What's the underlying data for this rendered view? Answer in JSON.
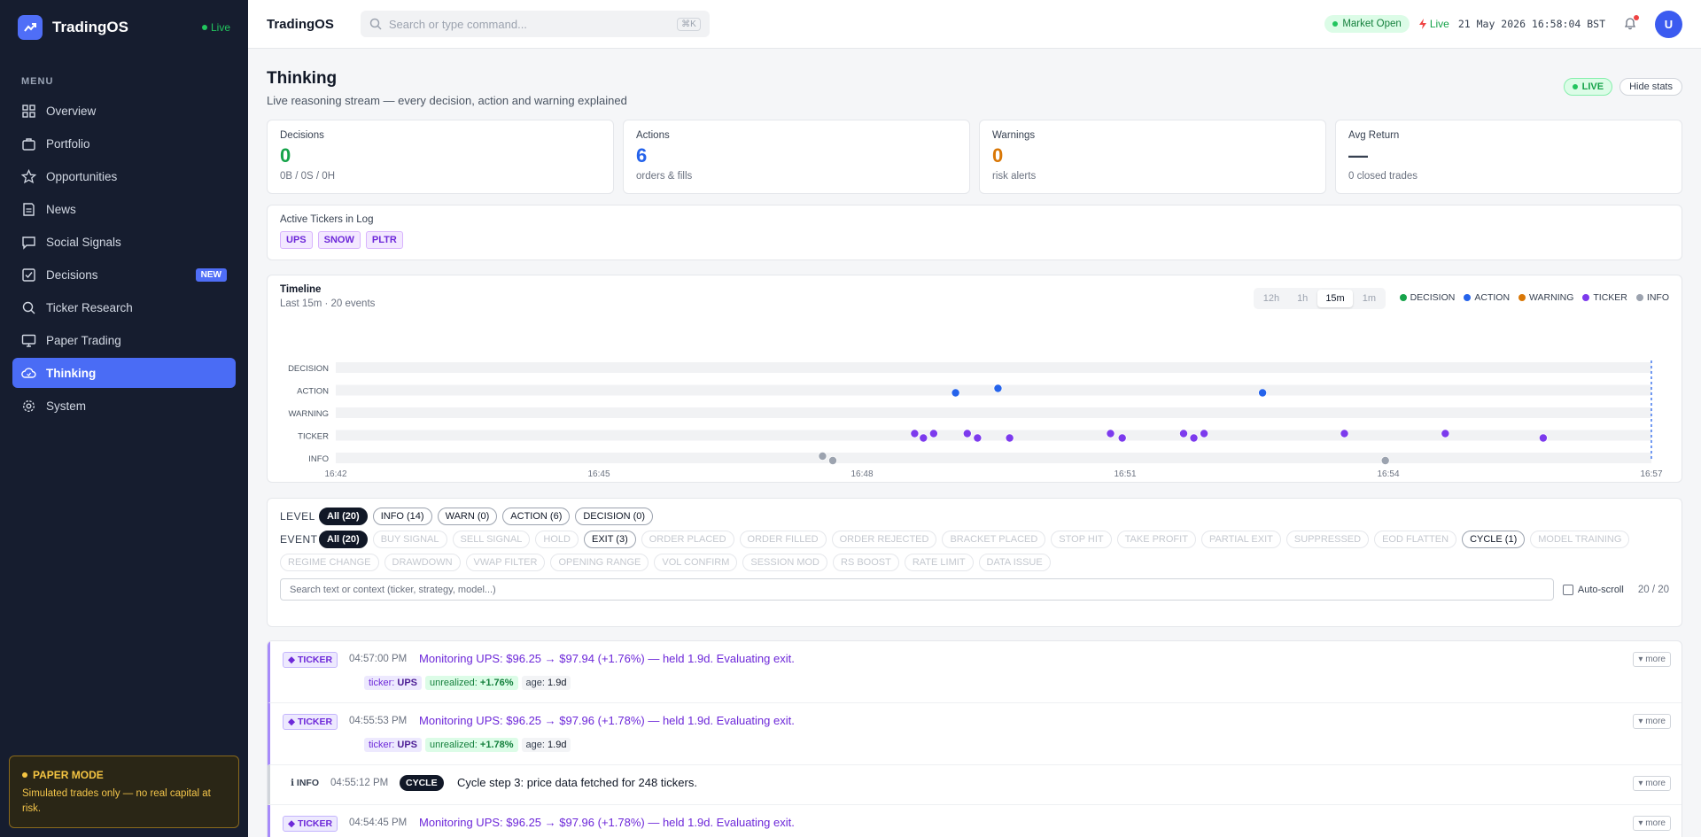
{
  "sidebar": {
    "brand": "TradingOS",
    "live": "Live",
    "menu_title": "MENU",
    "items": [
      {
        "label": "Overview",
        "icon": "grid-icon"
      },
      {
        "label": "Portfolio",
        "icon": "briefcase-icon"
      },
      {
        "label": "Opportunities",
        "icon": "star-icon"
      },
      {
        "label": "News",
        "icon": "newspaper-icon"
      },
      {
        "label": "Social Signals",
        "icon": "chat-icon"
      },
      {
        "label": "Decisions",
        "icon": "check-square-icon",
        "badge": "NEW"
      },
      {
        "label": "Ticker Research",
        "icon": "search-icon"
      },
      {
        "label": "Paper Trading",
        "icon": "monitor-icon"
      },
      {
        "label": "Thinking",
        "icon": "cloud-icon",
        "active": true
      },
      {
        "label": "System",
        "icon": "gear-icon"
      }
    ],
    "paper_mode": {
      "title": "PAPER MODE",
      "text": "Simulated trades only — no real capital at risk."
    }
  },
  "topbar": {
    "title": "TradingOS",
    "search_placeholder": "Search or type command...",
    "shortcut": "⌘K",
    "market": "Market Open",
    "live": "Live",
    "clock": "21 May 2026 16:58:04 BST",
    "avatar": "U"
  },
  "page": {
    "title": "Thinking",
    "subtitle": "Live reasoning stream — every decision, action and warning explained",
    "live_pill": "LIVE",
    "hide_stats": "Hide stats"
  },
  "stats": [
    {
      "label": "Decisions",
      "value": "0",
      "sub": "0B / 0S / 0H",
      "color": "#16a34a"
    },
    {
      "label": "Actions",
      "value": "6",
      "sub": "orders & fills",
      "color": "#2563eb"
    },
    {
      "label": "Warnings",
      "value": "0",
      "sub": "risk alerts",
      "color": "#d97706"
    },
    {
      "label": "Avg Return",
      "value": "—",
      "sub": "0 closed trades",
      "color": "#374151"
    }
  ],
  "active_tickers": {
    "label": "Active Tickers in Log",
    "items": [
      "UPS",
      "SNOW",
      "PLTR"
    ]
  },
  "timeline": {
    "title": "Timeline",
    "subtitle": "Last 15m · 20 events",
    "ranges": [
      "12h",
      "1h",
      "15m",
      "1m"
    ],
    "selected_range": "15m",
    "legend": [
      {
        "name": "DECISION",
        "color": "#16a34a"
      },
      {
        "name": "ACTION",
        "color": "#2563eb"
      },
      {
        "name": "WARNING",
        "color": "#d97706"
      },
      {
        "name": "TICKER",
        "color": "#7c3aed"
      },
      {
        "name": "INFO",
        "color": "#9ca3af"
      }
    ]
  },
  "chart_data": {
    "type": "scatter",
    "title": "Timeline",
    "lanes": [
      "DECISION",
      "ACTION",
      "WARNING",
      "TICKER",
      "INFO"
    ],
    "x_ticks": [
      "16:42",
      "16:45",
      "16:48",
      "16:51",
      "16:54",
      "16:57"
    ],
    "xlim": [
      "16:42:00",
      "16:57:00"
    ],
    "points": [
      {
        "t": "16:47:33",
        "lane": "INFO"
      },
      {
        "t": "16:47:40",
        "lane": "INFO"
      },
      {
        "t": "16:48:36",
        "lane": "TICKER"
      },
      {
        "t": "16:48:42",
        "lane": "TICKER"
      },
      {
        "t": "16:48:49",
        "lane": "TICKER"
      },
      {
        "t": "16:49:04",
        "lane": "ACTION"
      },
      {
        "t": "16:49:12",
        "lane": "TICKER"
      },
      {
        "t": "16:49:19",
        "lane": "TICKER"
      },
      {
        "t": "16:49:33",
        "lane": "ACTION"
      },
      {
        "t": "16:49:41",
        "lane": "TICKER"
      },
      {
        "t": "16:50:50",
        "lane": "TICKER"
      },
      {
        "t": "16:50:58",
        "lane": "TICKER"
      },
      {
        "t": "16:51:40",
        "lane": "TICKER"
      },
      {
        "t": "16:51:47",
        "lane": "TICKER"
      },
      {
        "t": "16:51:54",
        "lane": "TICKER"
      },
      {
        "t": "16:52:34",
        "lane": "ACTION"
      },
      {
        "t": "16:53:30",
        "lane": "TICKER"
      },
      {
        "t": "16:53:58",
        "lane": "INFO"
      },
      {
        "t": "16:54:39",
        "lane": "TICKER"
      },
      {
        "t": "16:55:46",
        "lane": "TICKER"
      }
    ]
  },
  "filters": {
    "level_label": "LEVEL",
    "levels": [
      {
        "label": "All (20)",
        "state": "on"
      },
      {
        "label": "INFO (14)",
        "state": "mid"
      },
      {
        "label": "WARN (0)",
        "state": "mid"
      },
      {
        "label": "ACTION (6)",
        "state": "mid"
      },
      {
        "label": "DECISION (0)",
        "state": "mid"
      }
    ],
    "event_label": "EVENT",
    "events": [
      {
        "label": "All (20)",
        "state": "on"
      },
      {
        "label": "BUY SIGNAL",
        "state": "off"
      },
      {
        "label": "SELL SIGNAL",
        "state": "off"
      },
      {
        "label": "HOLD",
        "state": "off"
      },
      {
        "label": "EXIT (3)",
        "state": "mid"
      },
      {
        "label": "ORDER PLACED",
        "state": "off"
      },
      {
        "label": "ORDER FILLED",
        "state": "off"
      },
      {
        "label": "ORDER REJECTED",
        "state": "off"
      },
      {
        "label": "BRACKET PLACED",
        "state": "off"
      },
      {
        "label": "STOP HIT",
        "state": "off"
      },
      {
        "label": "TAKE PROFIT",
        "state": "off"
      },
      {
        "label": "PARTIAL EXIT",
        "state": "off"
      },
      {
        "label": "SUPPRESSED",
        "state": "off"
      },
      {
        "label": "EOD FLATTEN",
        "state": "off"
      },
      {
        "label": "CYCLE (1)",
        "state": "mid"
      },
      {
        "label": "MODEL TRAINING",
        "state": "off"
      },
      {
        "label": "REGIME CHANGE",
        "state": "off"
      },
      {
        "label": "DRAWDOWN",
        "state": "off"
      },
      {
        "label": "VWAP FILTER",
        "state": "off"
      },
      {
        "label": "OPENING RANGE",
        "state": "off"
      },
      {
        "label": "VOL CONFIRM",
        "state": "off"
      },
      {
        "label": "SESSION MOD",
        "state": "off"
      },
      {
        "label": "RS BOOST",
        "state": "off"
      },
      {
        "label": "RATE LIMIT",
        "state": "off"
      },
      {
        "label": "DATA ISSUE",
        "state": "off"
      }
    ],
    "search_placeholder": "Search text or context (ticker, strategy, model...)",
    "autoscroll": "Auto-scroll",
    "count": "20 / 20"
  },
  "log": [
    {
      "level": "TICKER",
      "time": "04:57:00 PM",
      "msg": "Monitoring UPS: $96.25 → $97.94 (+1.76%) — held 1.9d. Evaluating exit.",
      "tags": {
        "ticker": "UPS",
        "unrealized": "+1.76%",
        "age": "1.9d"
      }
    },
    {
      "level": "TICKER",
      "time": "04:55:53 PM",
      "msg": "Monitoring UPS: $96.25 → $97.96 (+1.78%) — held 1.9d. Evaluating exit.",
      "tags": {
        "ticker": "UPS",
        "unrealized": "+1.78%",
        "age": "1.9d"
      }
    },
    {
      "level": "INFO",
      "time": "04:55:12 PM",
      "cycle": "CYCLE",
      "msg": "Cycle step 3: price data fetched for 248 tickers."
    },
    {
      "level": "TICKER",
      "time": "04:54:45 PM",
      "msg": "Monitoring UPS: $96.25 → $97.96 (+1.78%) — held 1.9d. Evaluating exit."
    }
  ],
  "log_labels": {
    "more": "▾ more",
    "ticker": "ticker:",
    "unrealized": "unrealized:",
    "age": "age:"
  }
}
